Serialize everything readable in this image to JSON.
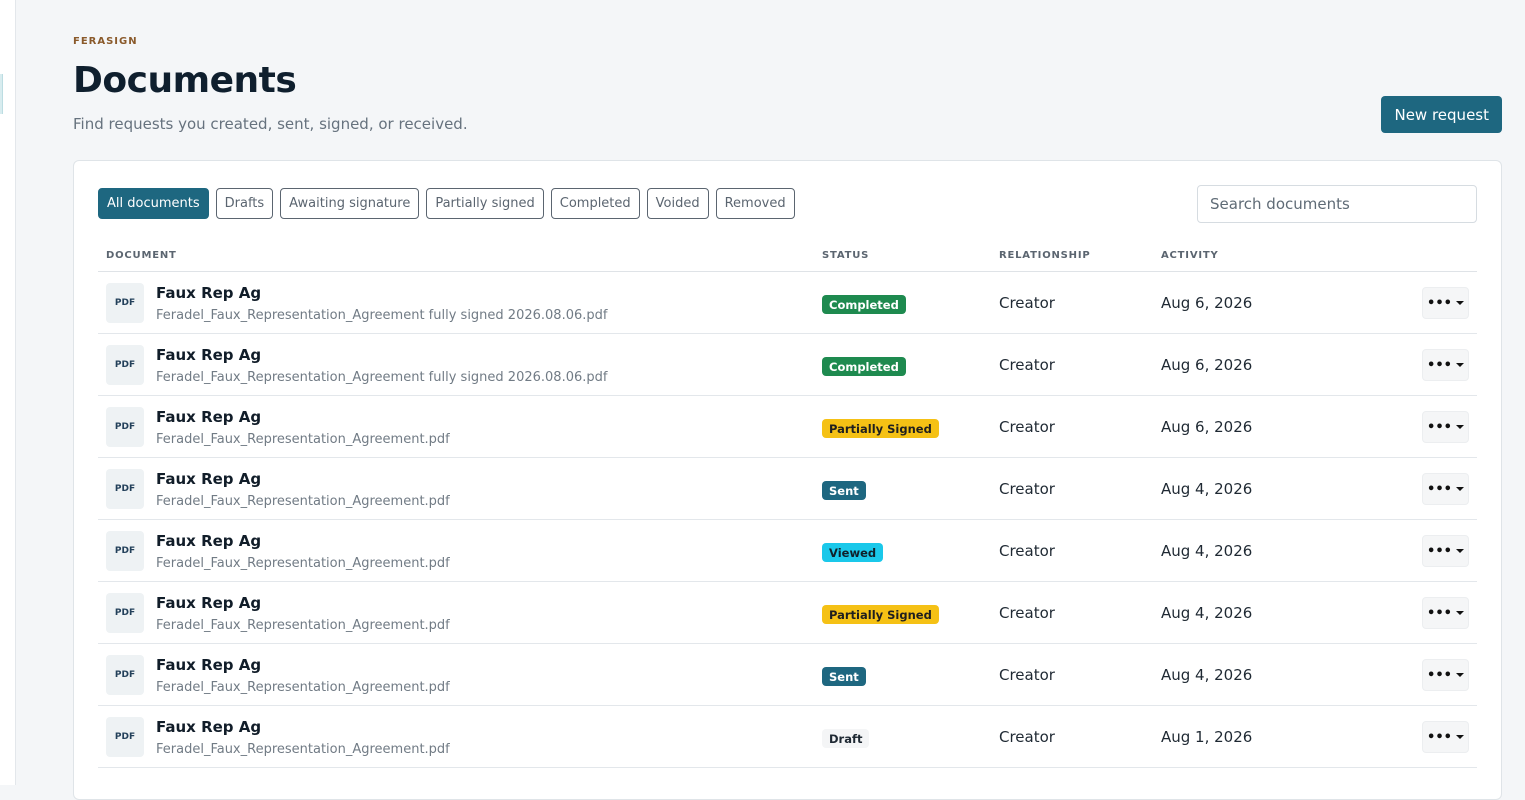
{
  "header": {
    "brand": "FERASIGN",
    "title": "Documents",
    "subtitle": "Find requests you created, sent, signed, or received.",
    "new_request_label": "New request"
  },
  "filters": [
    {
      "label": "All documents",
      "active": true
    },
    {
      "label": "Drafts",
      "active": false
    },
    {
      "label": "Awaiting signature",
      "active": false
    },
    {
      "label": "Partially signed",
      "active": false
    },
    {
      "label": "Completed",
      "active": false
    },
    {
      "label": "Voided",
      "active": false
    },
    {
      "label": "Removed",
      "active": false
    }
  ],
  "search": {
    "placeholder": "Search documents",
    "value": ""
  },
  "table": {
    "columns": {
      "document": "DOCUMENT",
      "status": "STATUS",
      "relationship": "RELATIONSHIP",
      "activity": "ACTIVITY"
    },
    "rows": [
      {
        "icon": "PDF",
        "name": "Faux Rep Ag",
        "file": "Feradel_Faux_Representation_Agreement fully signed 2026.08.06.pdf",
        "status": "Completed",
        "status_kind": "completed",
        "relationship": "Creator",
        "activity": "Aug 6, 2026"
      },
      {
        "icon": "PDF",
        "name": "Faux Rep Ag",
        "file": "Feradel_Faux_Representation_Agreement fully signed 2026.08.06.pdf",
        "status": "Completed",
        "status_kind": "completed",
        "relationship": "Creator",
        "activity": "Aug 6, 2026"
      },
      {
        "icon": "PDF",
        "name": "Faux Rep Ag",
        "file": "Feradel_Faux_Representation_Agreement.pdf",
        "status": "Partially Signed",
        "status_kind": "partial",
        "relationship": "Creator",
        "activity": "Aug 6, 2026"
      },
      {
        "icon": "PDF",
        "name": "Faux Rep Ag",
        "file": "Feradel_Faux_Representation_Agreement.pdf",
        "status": "Sent",
        "status_kind": "sent",
        "relationship": "Creator",
        "activity": "Aug 4, 2026"
      },
      {
        "icon": "PDF",
        "name": "Faux Rep Ag",
        "file": "Feradel_Faux_Representation_Agreement.pdf",
        "status": "Viewed",
        "status_kind": "viewed",
        "relationship": "Creator",
        "activity": "Aug 4, 2026"
      },
      {
        "icon": "PDF",
        "name": "Faux Rep Ag",
        "file": "Feradel_Faux_Representation_Agreement.pdf",
        "status": "Partially Signed",
        "status_kind": "partial",
        "relationship": "Creator",
        "activity": "Aug 4, 2026"
      },
      {
        "icon": "PDF",
        "name": "Faux Rep Ag",
        "file": "Feradel_Faux_Representation_Agreement.pdf",
        "status": "Sent",
        "status_kind": "sent",
        "relationship": "Creator",
        "activity": "Aug 4, 2026"
      },
      {
        "icon": "PDF",
        "name": "Faux Rep Ag",
        "file": "Feradel_Faux_Representation_Agreement.pdf",
        "status": "Draft",
        "status_kind": "draft",
        "relationship": "Creator",
        "activity": "Aug 1, 2026"
      }
    ],
    "more_label": "•••"
  },
  "status_colors": {
    "completed": {
      "bg": "#1e8a4f",
      "fg": "#ffffff"
    },
    "partial": {
      "bg": "#f5c115",
      "fg": "#1f1f1f"
    },
    "sent": {
      "bg": "#1e6780",
      "fg": "#ffffff"
    },
    "viewed": {
      "bg": "#1ac8ea",
      "fg": "#10202a"
    },
    "draft": {
      "bg": "#f4f5f6",
      "fg": "#1f2933"
    }
  },
  "colors": {
    "accent": "#1e6780",
    "brand": "#8a5a2b"
  }
}
